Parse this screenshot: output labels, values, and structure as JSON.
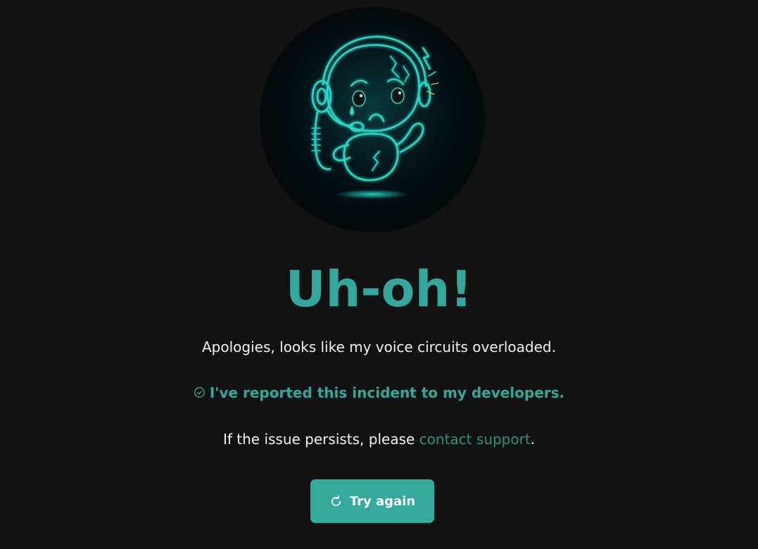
{
  "error": {
    "title": "Uh-oh!",
    "message": "Apologies, looks like my voice circuits overloaded.",
    "reported": "I've reported this incident to my developers.",
    "persist_prefix": "If the issue persists, please ",
    "support_link": "contact support",
    "persist_suffix": "."
  },
  "actions": {
    "retry_label": "Try again"
  },
  "icons": {
    "reported": "check-circle-icon",
    "retry": "refresh-icon",
    "illustration": "sad-robot-headset-illustration"
  },
  "colors": {
    "background": "#121213",
    "accent": "#34a79c",
    "link": "#2f8f84",
    "button": "#36a99d",
    "text": "#f2f2f2"
  }
}
